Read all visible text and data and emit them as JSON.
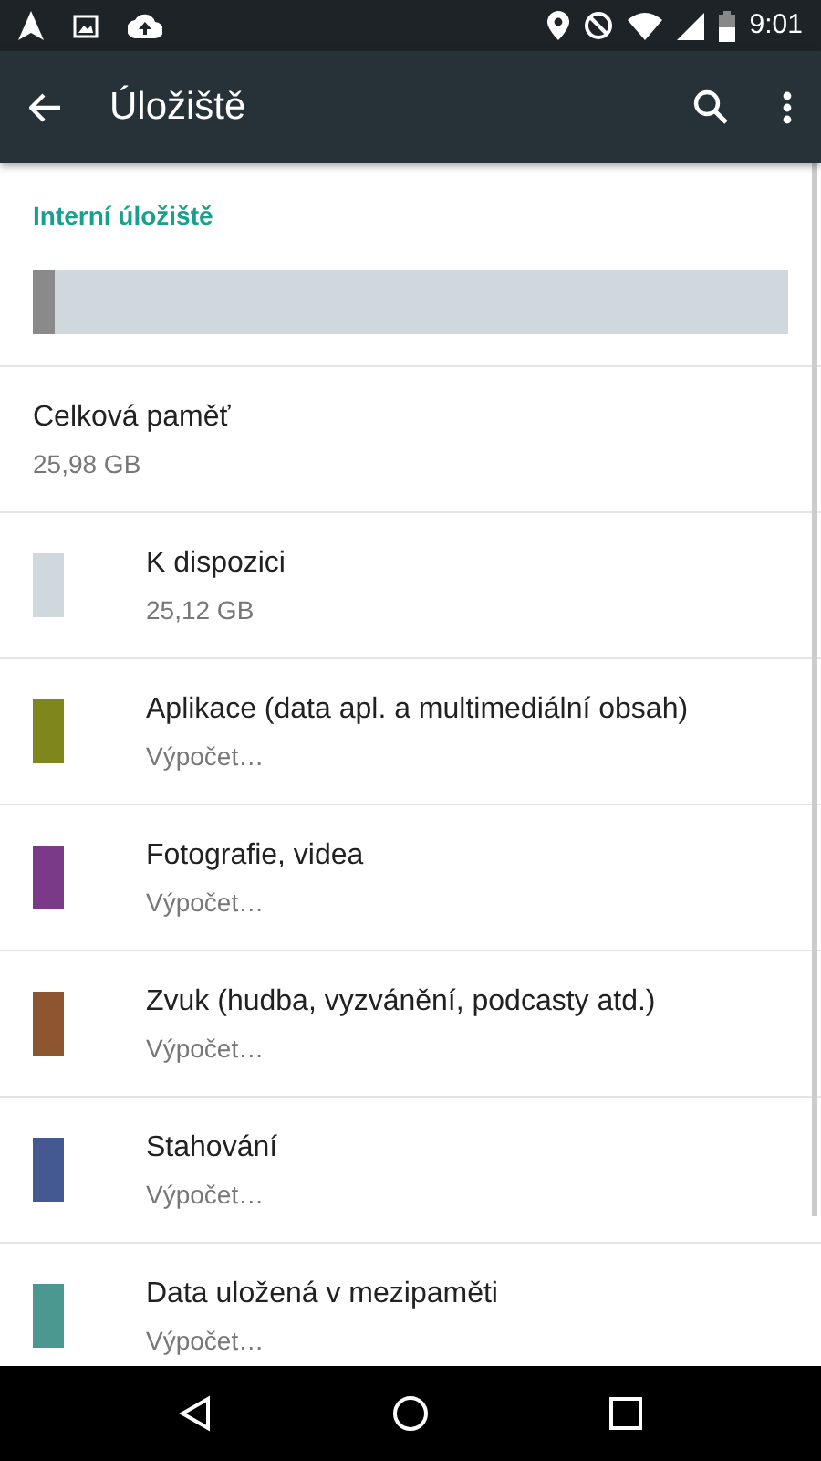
{
  "status_bar": {
    "time": "9:01"
  },
  "toolbar": {
    "title": "Úložiště"
  },
  "section": {
    "title": "Interní úložiště",
    "usage": {
      "level": 0.03
    }
  },
  "total": {
    "title": "Celková paměť",
    "value": "25,98 GB"
  },
  "items": [
    {
      "title": "K dispozici",
      "subtitle": "25,12 GB",
      "color": "#cfd8dc"
    },
    {
      "title": "Aplikace (data apl. a multimediální obsah)",
      "subtitle": "Výpočet…",
      "color": "#7e861c"
    },
    {
      "title": "Fotografie, videa",
      "subtitle": "Výpočet…",
      "color": "#7b3a87"
    },
    {
      "title": "Zvuk (hudba, vyzvánění, podcasty atd.)",
      "subtitle": "Výpočet…",
      "color": "#8e5630"
    },
    {
      "title": "Stahování",
      "subtitle": "Výpočet…",
      "color": "#44598f"
    },
    {
      "title": "Data uložená v mezipaměti",
      "subtitle": "Výpočet…",
      "color": "#4b9890"
    }
  ]
}
